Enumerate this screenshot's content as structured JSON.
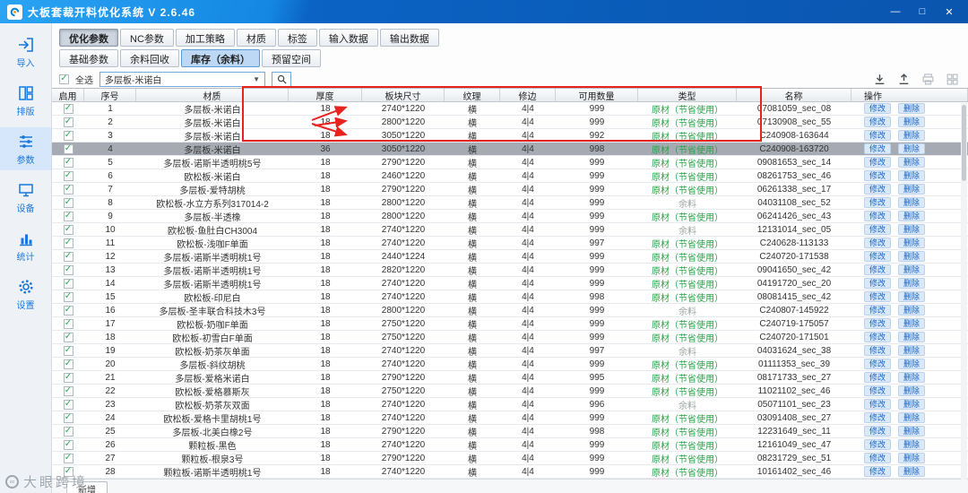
{
  "titlebar": {
    "title": "大板套裁开料优化系统  V 2.6.46",
    "minimize": "—",
    "maximize": "□",
    "close": "✕"
  },
  "sidebar": {
    "items": [
      {
        "label": "导入",
        "icon": "import-icon",
        "active": false
      },
      {
        "label": "排版",
        "icon": "layout-icon",
        "active": false
      },
      {
        "label": "参数",
        "icon": "params-icon",
        "active": true
      },
      {
        "label": "设备",
        "icon": "device-icon",
        "active": false
      },
      {
        "label": "统计",
        "icon": "stats-icon",
        "active": false
      },
      {
        "label": "设置",
        "icon": "settings-icon",
        "active": false
      }
    ]
  },
  "tabs_primary": [
    {
      "label": "优化参数",
      "active": true
    },
    {
      "label": "NC参数",
      "active": false
    },
    {
      "label": "加工策略",
      "active": false
    },
    {
      "label": "材质",
      "active": false
    },
    {
      "label": "标签",
      "active": false
    },
    {
      "label": "输入数据",
      "active": false
    },
    {
      "label": "输出数据",
      "active": false
    }
  ],
  "tabs_secondary": [
    {
      "label": "基础参数",
      "active": false
    },
    {
      "label": "余料回收",
      "active": false
    },
    {
      "label": "库存（余料）",
      "active": true
    },
    {
      "label": "预留空间",
      "active": false
    }
  ],
  "toolbar": {
    "select_all": "全选",
    "material_filter": "多层板-米诺白",
    "icons": [
      {
        "name": "export-icon",
        "gray": false
      },
      {
        "name": "share-icon",
        "gray": false
      },
      {
        "name": "print-icon",
        "gray": true
      },
      {
        "name": "grid-icon",
        "gray": true
      }
    ]
  },
  "table": {
    "columns": [
      "启用",
      "序号",
      "材质",
      "厚度",
      "板块尺寸",
      "纹理",
      "修边",
      "可用数量",
      "类型",
      "名称",
      "操作"
    ],
    "check_glyph": "✓",
    "actions": {
      "edit": "修改",
      "delete": "删除"
    },
    "rows": [
      {
        "no": 1,
        "material": "多层板-米诺白",
        "thickness": "18",
        "size": "2740*1220",
        "texture": "横",
        "trim": "4|4",
        "qty": "999",
        "type": "原材（节省使用）",
        "kind": "green",
        "name": "07081059_sec_08",
        "checked": true,
        "selected": false
      },
      {
        "no": 2,
        "material": "多层板-米诺白",
        "thickness": "18",
        "size": "2800*1220",
        "texture": "横",
        "trim": "4|4",
        "qty": "999",
        "type": "原材（节省使用）",
        "kind": "green",
        "name": "07130908_sec_55",
        "checked": true,
        "selected": false
      },
      {
        "no": 3,
        "material": "多层板-米诺白",
        "thickness": "18",
        "size": "3050*1220",
        "texture": "横",
        "trim": "4|4",
        "qty": "992",
        "type": "原材（节省使用）",
        "kind": "green",
        "name": "C240908-163644",
        "checked": true,
        "selected": false
      },
      {
        "no": 4,
        "material": "多层板-米诺白",
        "thickness": "36",
        "size": "3050*1220",
        "texture": "横",
        "trim": "4|4",
        "qty": "998",
        "type": "原材（节省使用）",
        "kind": "green",
        "name": "C240908-163720",
        "checked": true,
        "selected": true
      },
      {
        "no": 5,
        "material": "多层板-诺斯半透明桃5号",
        "thickness": "18",
        "size": "2790*1220",
        "texture": "横",
        "trim": "4|4",
        "qty": "999",
        "type": "原材（节省使用）",
        "kind": "green",
        "name": "09081653_sec_14",
        "checked": true,
        "selected": false
      },
      {
        "no": 6,
        "material": "欧松板-米诺白",
        "thickness": "18",
        "size": "2460*1220",
        "texture": "横",
        "trim": "4|4",
        "qty": "999",
        "type": "原材（节省使用）",
        "kind": "green",
        "name": "08261753_sec_46",
        "checked": true,
        "selected": false
      },
      {
        "no": 7,
        "material": "多层板-爱特胡桃",
        "thickness": "18",
        "size": "2790*1220",
        "texture": "横",
        "trim": "4|4",
        "qty": "999",
        "type": "原材（节省使用）",
        "kind": "green",
        "name": "06261338_sec_17",
        "checked": true,
        "selected": false
      },
      {
        "no": 8,
        "material": "欧松板-水立方系列317014-2",
        "thickness": "18",
        "size": "2800*1220",
        "texture": "横",
        "trim": "4|4",
        "qty": "999",
        "type": "余料",
        "kind": "gray",
        "name": "04031108_sec_52",
        "checked": true,
        "selected": false
      },
      {
        "no": 9,
        "material": "多层板-半透橡",
        "thickness": "18",
        "size": "2800*1220",
        "texture": "横",
        "trim": "4|4",
        "qty": "999",
        "type": "原材（节省使用）",
        "kind": "green",
        "name": "06241426_sec_43",
        "checked": true,
        "selected": false
      },
      {
        "no": 10,
        "material": "欧松板-鱼肚白CH3004",
        "thickness": "18",
        "size": "2740*1220",
        "texture": "横",
        "trim": "4|4",
        "qty": "999",
        "type": "余料",
        "kind": "gray",
        "name": "12131014_sec_05",
        "checked": true,
        "selected": false
      },
      {
        "no": 11,
        "material": "欧松板-浅咖F单面",
        "thickness": "18",
        "size": "2740*1220",
        "texture": "横",
        "trim": "4|4",
        "qty": "997",
        "type": "原材（节省使用）",
        "kind": "green",
        "name": "C240628-113133",
        "checked": true,
        "selected": false
      },
      {
        "no": 12,
        "material": "多层板-诺斯半透明桃1号",
        "thickness": "18",
        "size": "2440*1224",
        "texture": "横",
        "trim": "4|4",
        "qty": "999",
        "type": "原材（节省使用）",
        "kind": "green",
        "name": "C240720-171538",
        "checked": true,
        "selected": false
      },
      {
        "no": 13,
        "material": "多层板-诺斯半透明桃1号",
        "thickness": "18",
        "size": "2820*1220",
        "texture": "横",
        "trim": "4|4",
        "qty": "999",
        "type": "原材（节省使用）",
        "kind": "green",
        "name": "09041650_sec_42",
        "checked": true,
        "selected": false
      },
      {
        "no": 14,
        "material": "多层板-诺斯半透明桃1号",
        "thickness": "18",
        "size": "2740*1220",
        "texture": "横",
        "trim": "4|4",
        "qty": "999",
        "type": "原材（节省使用）",
        "kind": "green",
        "name": "04191720_sec_20",
        "checked": true,
        "selected": false
      },
      {
        "no": 15,
        "material": "欧松板-印尼白",
        "thickness": "18",
        "size": "2740*1220",
        "texture": "横",
        "trim": "4|4",
        "qty": "998",
        "type": "原材（节省使用）",
        "kind": "green",
        "name": "08081415_sec_42",
        "checked": true,
        "selected": false
      },
      {
        "no": 16,
        "material": "多层板-圣丰联合科技木3号",
        "thickness": "18",
        "size": "2800*1220",
        "texture": "横",
        "trim": "4|4",
        "qty": "999",
        "type": "余料",
        "kind": "gray",
        "name": "C240807-145922",
        "checked": true,
        "selected": false
      },
      {
        "no": 17,
        "material": "欧松板-奶咖F单面",
        "thickness": "18",
        "size": "2750*1220",
        "texture": "横",
        "trim": "4|4",
        "qty": "999",
        "type": "原材（节省使用）",
        "kind": "green",
        "name": "C240719-175057",
        "checked": true,
        "selected": false
      },
      {
        "no": 18,
        "material": "欧松板-初雪白F单面",
        "thickness": "18",
        "size": "2750*1220",
        "texture": "横",
        "trim": "4|4",
        "qty": "999",
        "type": "原材（节省使用）",
        "kind": "green",
        "name": "C240720-171501",
        "checked": true,
        "selected": false
      },
      {
        "no": 19,
        "material": "欧松板-奶茶灰单面",
        "thickness": "18",
        "size": "2740*1220",
        "texture": "横",
        "trim": "4|4",
        "qty": "997",
        "type": "余料",
        "kind": "gray",
        "name": "04031624_sec_38",
        "checked": true,
        "selected": false
      },
      {
        "no": 20,
        "material": "多层板-斜纹胡桃",
        "thickness": "18",
        "size": "2740*1220",
        "texture": "横",
        "trim": "4|4",
        "qty": "999",
        "type": "原材（节省使用）",
        "kind": "green",
        "name": "01111353_sec_39",
        "checked": true,
        "selected": false
      },
      {
        "no": 21,
        "material": "多层板-爱格米诺白",
        "thickness": "18",
        "size": "2790*1220",
        "texture": "横",
        "trim": "4|4",
        "qty": "995",
        "type": "原材（节省使用）",
        "kind": "green",
        "name": "08171733_sec_27",
        "checked": true,
        "selected": false
      },
      {
        "no": 22,
        "material": "欧松板-爱格慕斯灰",
        "thickness": "18",
        "size": "2750*1220",
        "texture": "横",
        "trim": "4|4",
        "qty": "999",
        "type": "原材（节省使用）",
        "kind": "green",
        "name": "11021102_sec_46",
        "checked": true,
        "selected": false
      },
      {
        "no": 23,
        "material": "欧松板-奶茶灰双面",
        "thickness": "18",
        "size": "2740*1220",
        "texture": "横",
        "trim": "4|4",
        "qty": "996",
        "type": "余料",
        "kind": "gray",
        "name": "05071101_sec_23",
        "checked": true,
        "selected": false
      },
      {
        "no": 24,
        "material": "欧松板-爱格卡里胡桃1号",
        "thickness": "18",
        "size": "2740*1220",
        "texture": "横",
        "trim": "4|4",
        "qty": "999",
        "type": "原材（节省使用）",
        "kind": "green",
        "name": "03091408_sec_27",
        "checked": true,
        "selected": false
      },
      {
        "no": 25,
        "material": "多层板-北美白橡2号",
        "thickness": "18",
        "size": "2790*1220",
        "texture": "横",
        "trim": "4|4",
        "qty": "998",
        "type": "原材（节省使用）",
        "kind": "green",
        "name": "12231649_sec_11",
        "checked": true,
        "selected": false
      },
      {
        "no": 26,
        "material": "颗粒板-黑色",
        "thickness": "18",
        "size": "2740*1220",
        "texture": "横",
        "trim": "4|4",
        "qty": "999",
        "type": "原材（节省使用）",
        "kind": "green",
        "name": "12161049_sec_47",
        "checked": true,
        "selected": false
      },
      {
        "no": 27,
        "material": "颗粒板-根泉3号",
        "thickness": "18",
        "size": "2790*1220",
        "texture": "横",
        "trim": "4|4",
        "qty": "999",
        "type": "原材（节省使用）",
        "kind": "green",
        "name": "08231729_sec_51",
        "checked": true,
        "selected": false
      },
      {
        "no": 28,
        "material": "颗粒板-诺斯半透明桃1号",
        "thickness": "18",
        "size": "2740*1220",
        "texture": "横",
        "trim": "4|4",
        "qty": "999",
        "type": "原材（节省使用）",
        "kind": "green",
        "name": "10161402_sec_46",
        "checked": true,
        "selected": false
      }
    ]
  },
  "footer": {
    "add_button": "新增"
  },
  "watermark": "大眼跨境",
  "annotation": {
    "color": "#e8231d"
  }
}
